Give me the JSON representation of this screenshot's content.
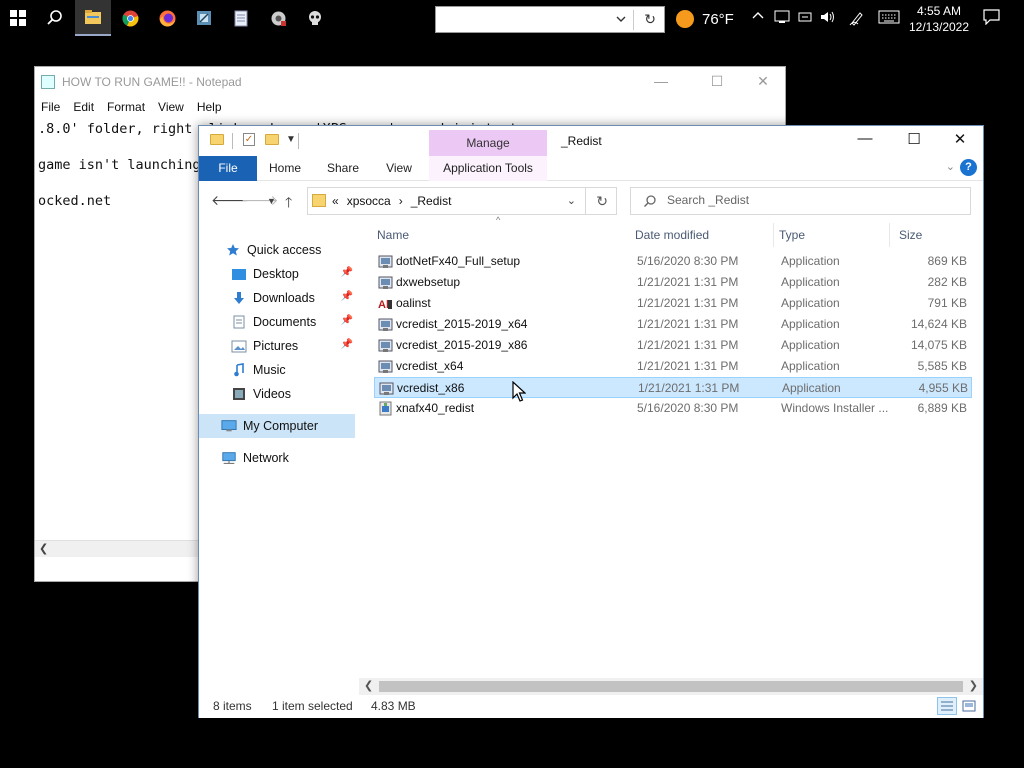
{
  "taskbar": {
    "address_placeholder": "",
    "weather_temp": "76°F",
    "clock_time": "4:55 AM",
    "clock_date": "12/13/2022",
    "pinned_icons": [
      "start-icon",
      "search-icon",
      "file-explorer-icon",
      "chrome-icon",
      "firefox-icon",
      "app-icon",
      "notes-icon",
      "game-icon",
      "skull-icon"
    ]
  },
  "notepad": {
    "title": "HOW TO RUN GAME!! - Notepad",
    "menu": [
      "File",
      "Edit",
      "Format",
      "View",
      "Help"
    ],
    "lines": [
      ".8.0' folder, right click and run 'XPSoccer' as administrator",
      "",
      "game isn't launching",
      "",
      "ocked.net"
    ]
  },
  "explorer": {
    "title": "_Redist",
    "manage_tab": "Manage",
    "ribbon_tabs": [
      "File",
      "Home",
      "Share",
      "View",
      "Application Tools"
    ],
    "breadcrumb": [
      "xpsocca",
      "_Redist"
    ],
    "breadcrumb_overflow": "«",
    "search_placeholder": "Search _Redist",
    "nav": {
      "quick_access": "Quick access",
      "items": [
        "Desktop",
        "Downloads",
        "Documents",
        "Pictures",
        "Music",
        "Videos"
      ],
      "my_computer": "My Computer",
      "network": "Network"
    },
    "columns": [
      "Name",
      "Date modified",
      "Type",
      "Size"
    ],
    "files": [
      {
        "name": "dotNetFx40_Full_setup",
        "date": "5/16/2020 8:30 PM",
        "type": "Application",
        "size": "869 KB"
      },
      {
        "name": "dxwebsetup",
        "date": "1/21/2021 1:31 PM",
        "type": "Application",
        "size": "282 KB"
      },
      {
        "name": "oalinst",
        "date": "1/21/2021 1:31 PM",
        "type": "Application",
        "size": "791 KB"
      },
      {
        "name": "vcredist_2015-2019_x64",
        "date": "1/21/2021 1:31 PM",
        "type": "Application",
        "size": "14,624 KB"
      },
      {
        "name": "vcredist_2015-2019_x86",
        "date": "1/21/2021 1:31 PM",
        "type": "Application",
        "size": "14,075 KB"
      },
      {
        "name": "vcredist_x64",
        "date": "1/21/2021 1:31 PM",
        "type": "Application",
        "size": "5,585 KB"
      },
      {
        "name": "vcredist_x86",
        "date": "1/21/2021 1:31 PM",
        "type": "Application",
        "size": "4,955 KB"
      },
      {
        "name": "xnafx40_redist",
        "date": "5/16/2020 8:30 PM",
        "type": "Windows Installer ...",
        "size": "6,889 KB"
      }
    ],
    "selected_index": 6,
    "status": {
      "count": "8 items",
      "selection": "1 item selected",
      "size": "4.83 MB"
    }
  },
  "colors": {
    "accent": "#1a62b4",
    "selection": "#cce8ff",
    "manage_tab": "#ecc8f5"
  }
}
